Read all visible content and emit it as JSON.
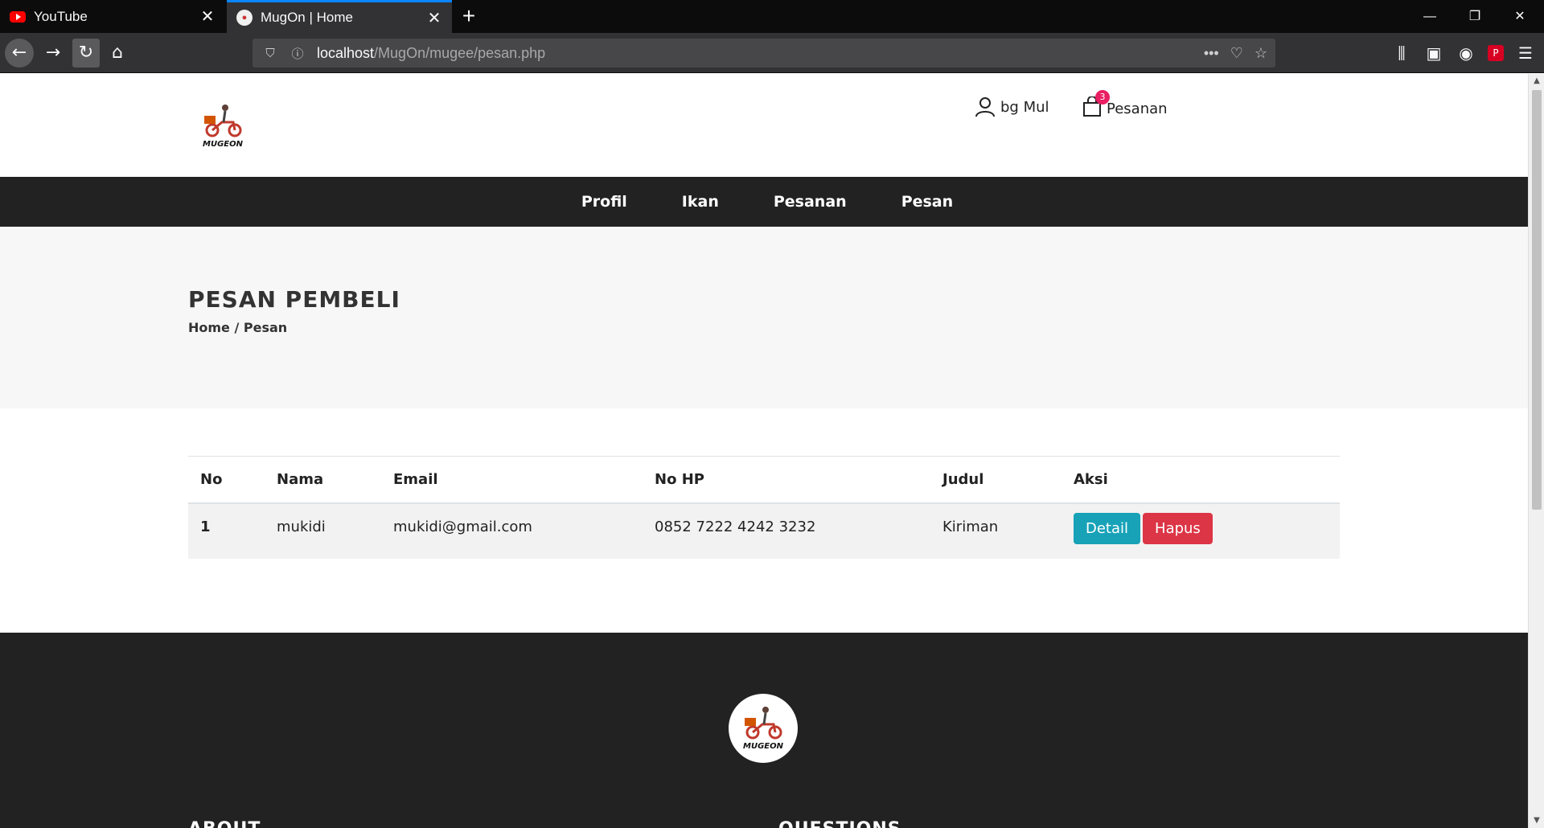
{
  "browser": {
    "tabs": [
      {
        "title": "YouTube"
      },
      {
        "title": "MugOn | Home"
      }
    ],
    "url_host": "localhost",
    "url_path": "/MugOn/mugee/pesan.php"
  },
  "header": {
    "logo_text": "MUGEON",
    "user_name": "bg Mul",
    "cart_label": "Pesanan",
    "cart_count": "3"
  },
  "nav": {
    "items": [
      "Profil",
      "Ikan",
      "Pesanan",
      "Pesan"
    ]
  },
  "page_title": {
    "title": "PESAN PEMBELI",
    "breadcrumb": "Home / Pesan"
  },
  "table": {
    "headers": [
      "No",
      "Nama",
      "Email",
      "No HP",
      "Judul",
      "Aksi"
    ],
    "rows": [
      {
        "no": "1",
        "nama": "mukidi",
        "email": "mukidi@gmail.com",
        "hp": "0852 7222 4242 3232",
        "judul": "Kiriman"
      }
    ],
    "detail_label": "Detail",
    "delete_label": "Hapus"
  },
  "footer": {
    "about_heading": "ABOUT",
    "questions_heading": "QUESTIONS"
  },
  "colors": {
    "nav_bg": "#222222",
    "detail_btn": "#17a2b8",
    "delete_btn": "#dc3545",
    "badge": "#e91e63"
  }
}
